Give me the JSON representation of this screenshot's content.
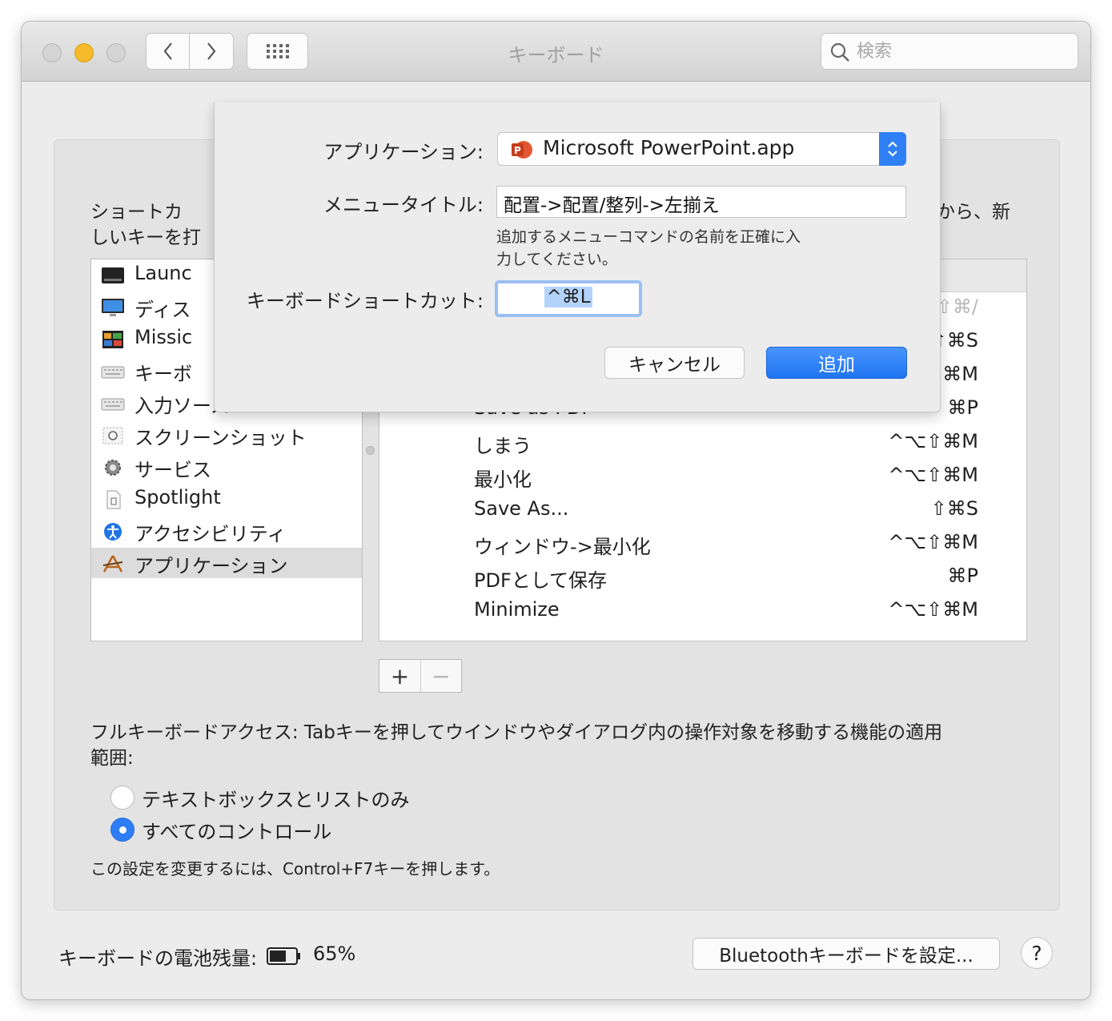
{
  "window": {
    "title": "キーボード"
  },
  "search": {
    "placeholder": "検索"
  },
  "instruction": {
    "line1_left": "ショートカ",
    "line2_left": "しいキーを打",
    "line1_right": "てから、新"
  },
  "categories": [
    {
      "label": "Launc",
      "icon": "launchpad-icon"
    },
    {
      "label": "ディス",
      "icon": "display-icon"
    },
    {
      "label": "Missic",
      "icon": "mission-control-icon"
    },
    {
      "label": "キーボ",
      "icon": "keyboard-icon"
    },
    {
      "label": "入力ソース",
      "icon": "input-sources-icon"
    },
    {
      "label": "スクリーンショット",
      "icon": "screenshot-icon"
    },
    {
      "label": "サービス",
      "icon": "gear-icon"
    },
    {
      "label": "Spotlight",
      "icon": "spotlight-icon"
    },
    {
      "label": "アクセシビリティ",
      "icon": "accessibility-icon"
    },
    {
      "label": "アプリケーション",
      "icon": "app-store-icon",
      "selected": true
    }
  ],
  "shortcuts": [
    {
      "name": "",
      "keys": "⇧⌘/",
      "dim": true
    },
    {
      "name": "",
      "keys": "⇧⌘S"
    },
    {
      "name": "",
      "keys": "⌥⇧⌘M"
    },
    {
      "name": "Save as PDF",
      "keys": "⌘P"
    },
    {
      "name": "しまう",
      "keys": "^⌥⇧⌘M"
    },
    {
      "name": "最小化",
      "keys": "^⌥⇧⌘M"
    },
    {
      "name": "Save As...",
      "keys": "⇧⌘S"
    },
    {
      "name": "ウィンドウ->最小化",
      "keys": "^⌥⇧⌘M"
    },
    {
      "name": "PDFとして保存",
      "keys": "⌘P"
    },
    {
      "name": "Minimize",
      "keys": "^⌥⇧⌘M"
    }
  ],
  "buttons": {
    "plus": "+",
    "minus": "−"
  },
  "full_keyboard_access": {
    "line1": "フルキーボードアクセス: Tabキーを押してウインドウやダイアログ内の操作対象を移動する機能の適用",
    "line2": "範囲:",
    "options": [
      {
        "label": "テキストボックスとリストのみ",
        "selected": false
      },
      {
        "label": "すべてのコントロール",
        "selected": true
      }
    ],
    "note": "この設定を変更するには、Control+F7キーを押します。"
  },
  "battery": {
    "label": "キーボードの電池残量:",
    "value": "65%",
    "level": 0.65
  },
  "bluetooth_button": "Bluetoothキーボードを設定...",
  "help_button": "?",
  "sheet": {
    "app_label": "アプリケーション:",
    "app_value": "Microsoft PowerPoint.app",
    "menu_title_label": "メニュータイトル:",
    "menu_title_value": "配置->配置/整列->左揃え",
    "helper_line1": "追加するメニューコマンドの名前を正確に入",
    "helper_line2": "力してください。",
    "shortcut_label": "キーボードショートカット:",
    "shortcut_value": "^⌘L",
    "cancel": "キャンセル",
    "add": "追加"
  },
  "colors": {
    "accent": "#2f7ff5",
    "yellow_light": "#f6bb2b"
  }
}
